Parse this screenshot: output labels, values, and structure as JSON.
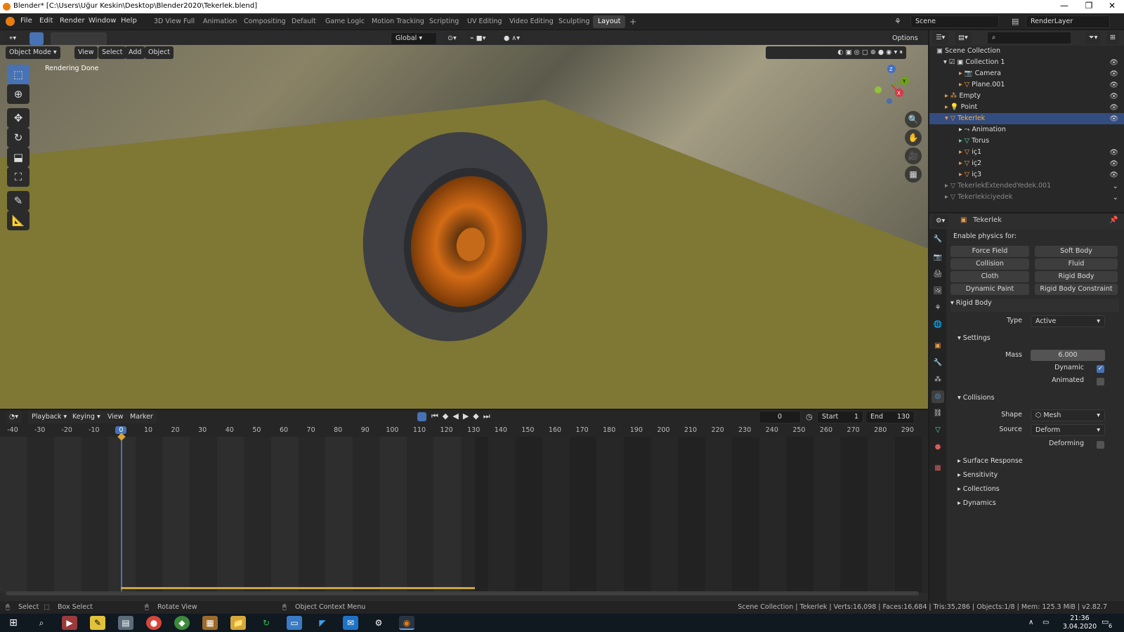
{
  "titlebar": {
    "title": "Blender* [C:\\Users\\Uğur Keskin\\Desktop\\Blender2020\\Tekerlek.blend]",
    "minimize": "—",
    "restore": "❐",
    "close": "✕"
  },
  "menu": [
    "File",
    "Edit",
    "Render",
    "Window",
    "Help"
  ],
  "workspaces": [
    "3D View Full",
    "Animation",
    "Compositing",
    "Default",
    "Game Logic",
    "Motion Tracking",
    "Scripting",
    "UV Editing",
    "Video Editing",
    "Sculpting",
    "Layout"
  ],
  "workspace_active": "Layout",
  "add_workspace": "+",
  "scene": {
    "scene_name": "Scene",
    "layer_name": "RenderLayer"
  },
  "viewport_header": {
    "mode": "Object Mode",
    "view": "View",
    "select": "Select",
    "add": "Add",
    "object": "Object",
    "orientation": "Global",
    "options": "Options"
  },
  "viewport": {
    "status_text": "Rendering Done"
  },
  "gizmo": {
    "x": "X",
    "y": "Y",
    "z": "Z"
  },
  "timeline": {
    "playback": "Playback",
    "keying": "Keying",
    "view": "View",
    "marker": "Marker",
    "current_frame": "0",
    "start_label": "Start",
    "start": "1",
    "end_label": "End",
    "end": "130",
    "ticks": [
      "-40",
      "-30",
      "-20",
      "-10",
      "0",
      "10",
      "20",
      "30",
      "40",
      "50",
      "60",
      "70",
      "80",
      "90",
      "100",
      "110",
      "120",
      "130",
      "140",
      "150",
      "160",
      "170",
      "180",
      "190",
      "200",
      "210",
      "220",
      "230",
      "240",
      "250",
      "260",
      "270",
      "280",
      "290"
    ]
  },
  "outliner": {
    "root": "Scene Collection",
    "items": [
      {
        "label": "Collection 1"
      },
      {
        "label": "Camera"
      },
      {
        "label": "Plane.001"
      },
      {
        "label": "Empty"
      },
      {
        "label": "Point"
      },
      {
        "label": "Tekerlek"
      },
      {
        "label": "Animation"
      },
      {
        "label": "Torus"
      },
      {
        "label": "iç1"
      },
      {
        "label": "iç2"
      },
      {
        "label": "iç3"
      },
      {
        "label": "TekerlekExtendedYedek.001"
      },
      {
        "label": "Tekerlekiciyedek"
      }
    ]
  },
  "properties": {
    "object_name": "Tekerlek",
    "enable_physics_label": "Enable physics for:",
    "physics_buttons": [
      "Force Field",
      "Soft Body",
      "Collision",
      "Fluid",
      "Cloth",
      "Rigid Body",
      "Dynamic Paint",
      "Rigid Body Constraint"
    ],
    "rigid_body": {
      "title": "Rigid Body",
      "type_label": "Type",
      "type_value": "Active",
      "settings_title": "Settings",
      "mass_label": "Mass",
      "mass_value": "6.000",
      "dynamic_label": "Dynamic",
      "dynamic_checked": true,
      "animated_label": "Animated",
      "animated_checked": false,
      "collisions_title": "Collisions",
      "shape_label": "Shape",
      "shape_value": "Mesh",
      "source_label": "Source",
      "source_value": "Deform",
      "deforming_label": "Deforming",
      "deforming_checked": false,
      "subsections": [
        "Surface Response",
        "Sensitivity",
        "Collections",
        "Dynamics"
      ]
    }
  },
  "statusbar": {
    "select": "Select",
    "box_select": "Box Select",
    "rotate_view": "Rotate View",
    "context_menu": "Object Context Menu",
    "stats": "Scene Collection | Tekerlek | Verts:16,098 | Faces:16,684 | Tris:35,286 | Objects:1/8 | Mem: 125.3 MiB | v2.82.7"
  },
  "taskbar": {
    "time": "21:36",
    "date": "3.04.2020",
    "notification_count": "6"
  }
}
